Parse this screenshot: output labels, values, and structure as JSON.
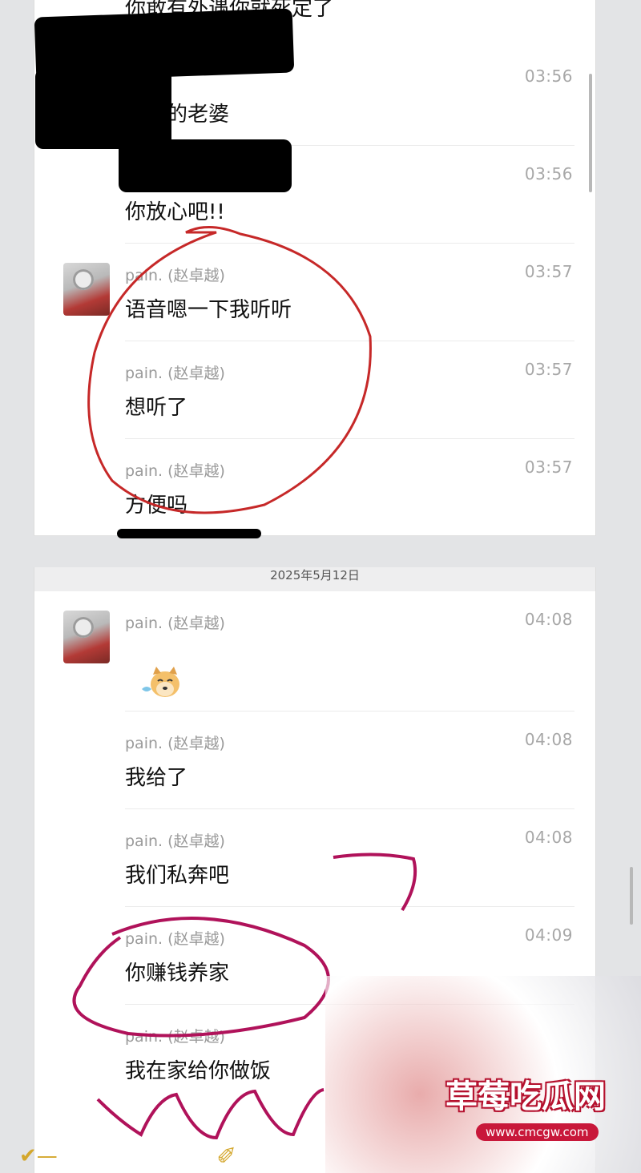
{
  "top_section": {
    "partial_message": "你敢有外遇你就死定了",
    "messages": [
      {
        "time": "03:56",
        "text": "不会的老婆"
      },
      {
        "time": "03:56",
        "text": "你放心吧!!"
      },
      {
        "sender": "pain. (赵卓越)",
        "time": "03:57",
        "text": "语音嗯一下我听听"
      },
      {
        "sender": "pain. (赵卓越)",
        "time": "03:57",
        "text": "想听了"
      },
      {
        "sender": "pain. (赵卓越)",
        "time": "03:57",
        "text": "方便吗"
      }
    ]
  },
  "date_divider": "2025年5月12日",
  "bottom_section": {
    "messages": [
      {
        "sender": "pain. (赵卓越)",
        "time": "04:08",
        "sticker": "crying-dog-sticker"
      },
      {
        "sender": "pain. (赵卓越)",
        "time": "04:08",
        "text": "我给了"
      },
      {
        "sender": "pain. (赵卓越)",
        "time": "04:08",
        "text": "我们私奔吧"
      },
      {
        "sender": "pain. (赵卓越)",
        "time": "04:09",
        "text": "你赚钱养家"
      },
      {
        "sender": "pain. (赵卓越)",
        "text": "我在家给你做饭"
      }
    ]
  },
  "watermark": {
    "title": "草莓吃瓜网",
    "url": "www.cmcgw.com"
  },
  "colors": {
    "annotation_red": "#c62828",
    "annotation_magenta": "#b0125a",
    "accent": "#d4a72c"
  }
}
